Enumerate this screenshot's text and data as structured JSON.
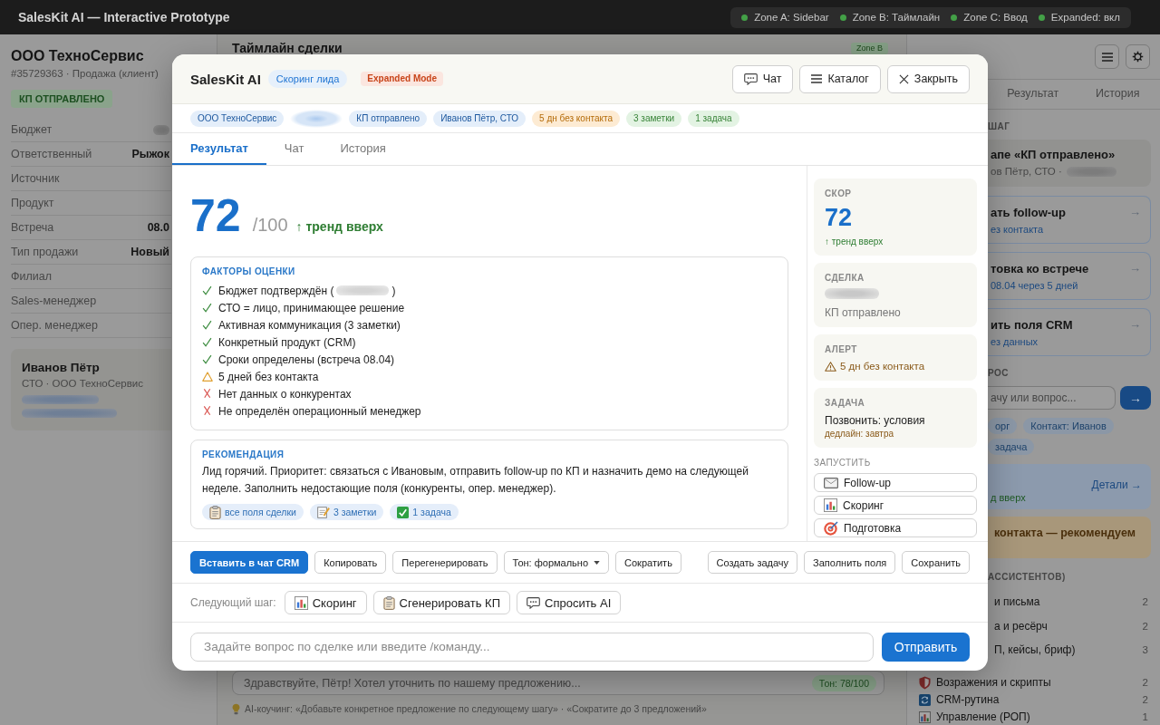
{
  "top_bar": {
    "title": "SalesKit AI — Interactive Prototype",
    "zones": [
      {
        "label": "Zone A: Sidebar",
        "active": true
      },
      {
        "label": "Zone B: Таймлайн",
        "active": true
      },
      {
        "label": "Zone C: Ввод",
        "active": true
      },
      {
        "label": "Expanded: вкл",
        "active": true
      }
    ]
  },
  "deal_sidebar": {
    "company": "ООО ТехноСервис",
    "subtitle": "#35729363 · Продажа (клиент)",
    "stage": "КП ОТПРАВЛЕНО",
    "fields": [
      {
        "label": "Бюджет",
        "value_blurred": true
      },
      {
        "label": "Ответственный",
        "value": "Рыжок"
      },
      {
        "label": "Источник"
      },
      {
        "label": "Продукт"
      },
      {
        "label": "Встреча",
        "value": "08.0"
      },
      {
        "label": "Тип продажи",
        "value": "Новый"
      },
      {
        "label": "Филиал"
      },
      {
        "label": "Sales-менеджер"
      },
      {
        "label": "Опер. менеджер"
      }
    ],
    "contact": {
      "name": "Иванов Пётр",
      "role": "СТО · ООО ТехноСервис",
      "blurred_lines": [
        {
          "kind": "link"
        },
        {
          "kind": "link"
        }
      ]
    }
  },
  "timeline": {
    "title": "Таймлайн сделки",
    "zone_badge": "Zone B",
    "draft": "Здравствуйте, Пётр! Хотел уточнить по нашему предложению...",
    "tone": "Тон: 78/100",
    "coaching": "AI-коучинг: «Добавьте конкретное предложение по следующему шагу» · «Сократите до 3 предложений»"
  },
  "assistant_panel": {
    "tabs": [
      {
        "label": "Результат",
        "selected": false
      },
      {
        "label": "История",
        "selected": false
      }
    ],
    "step_heading": "ШАГ",
    "step_card": {
      "title": "апе «КП отправлено»",
      "detail": "ов Пётр, СТО ·",
      "detail_blurred": true
    },
    "suggestions": [
      {
        "title": "ать follow-up",
        "note": "ез контакта",
        "arrow": "→"
      },
      {
        "title": "товка ко встрече",
        "note": "08.04 через 5 дней",
        "arrow": "→"
      },
      {
        "title": "ить поля CRM",
        "note": "ез данных",
        "arrow": "→"
      }
    ],
    "ask_heading": "РОС",
    "ask_placeholder": "ачу или вопрос...",
    "ask_send": "→",
    "chips": [
      "орг",
      "Контакт: Иванов",
      "задача"
    ],
    "score_card": {
      "trend": "д вверх",
      "link": "Детали →"
    },
    "alert_card": "контакта — рекомендуем",
    "catalog_heading": "АССИСТЕНТОВ)",
    "catalog_cut": [
      {
        "label": "и письма",
        "count": "2"
      },
      {
        "label": "а и ресёрч",
        "count": "2"
      },
      {
        "label": "П, кейсы, бриф)",
        "count": "3"
      }
    ],
    "catalog": [
      {
        "label": "Возражения и скрипты",
        "count": "2",
        "kind": "objections"
      },
      {
        "label": "CRM-рутина",
        "count": "2",
        "kind": "crm"
      },
      {
        "label": "Управление (РОП)",
        "count": "1",
        "kind": "management"
      }
    ]
  },
  "dialog": {
    "title": "SalesKit AI",
    "badges": [
      {
        "text": "Скоринг лида",
        "kind": "assistant",
        "color": "#e6f0fb"
      },
      {
        "text": "Expanded Mode",
        "kind": "mode",
        "color": "#fbe6df"
      }
    ],
    "header_buttons": [
      {
        "label": "Чат",
        "kind": "chat"
      },
      {
        "label": "Каталог",
        "kind": "catalog"
      },
      {
        "label": "Закрыть",
        "kind": "close"
      }
    ],
    "context_chips": [
      {
        "text": "ООО ТехноСервис",
        "color": "#e4eefa"
      },
      {
        "value_blurred": true,
        "color": "#d6e5f7"
      },
      {
        "text": "КП отправлено",
        "color": "#e4eefa"
      },
      {
        "text": "Иванов Пётр, СТО",
        "color": "#e4eefa"
      },
      {
        "text": "5 дн без контакта",
        "color": "#fdebd3"
      },
      {
        "text": "3 заметки",
        "color": "#e3f3e3"
      },
      {
        "text": "1 задача",
        "color": "#e3f3e3"
      }
    ],
    "tabs": [
      {
        "label": "Результат",
        "selected": true
      },
      {
        "label": "Чат",
        "selected": false
      },
      {
        "label": "История",
        "selected": false
      }
    ],
    "score": {
      "value": "72",
      "max": "/100",
      "trend": "↑ тренд вверх"
    },
    "factors": {
      "heading": "ФАКТОРЫ ОЦЕНКИ",
      "items": [
        {
          "kind": "ok",
          "text": "Бюджет подтверждён (",
          "value_blurred": true,
          "text_after": ")"
        },
        {
          "kind": "ok",
          "text": "СТО = лицо, принимающее решение"
        },
        {
          "kind": "ok",
          "text": "Активная коммуникация (3 заметки)"
        },
        {
          "kind": "ok",
          "text": "Конкретный продукт (CRM)"
        },
        {
          "kind": "ok",
          "text": "Сроки определены (встреча 08.04)"
        },
        {
          "kind": "warning",
          "text": "5 дней без контакта"
        },
        {
          "kind": "missing",
          "text": "Нет данных о конкурентах"
        },
        {
          "kind": "missing",
          "text": "Не определён операционный менеджер"
        }
      ]
    },
    "recommendation": {
      "heading": "РЕКОМЕНДАЦИЯ",
      "text": "Лид горячий. Приоритет: связаться с Ивановым, отправить follow-up по КП и назначить демо на следующей неделе. Заполнить недостающие поля (конкуренты, опер. менеджер).",
      "sources": [
        {
          "label": "все поля сделки",
          "kind": "fields"
        },
        {
          "label": "3 заметки",
          "kind": "notes"
        },
        {
          "label": "1 задача",
          "kind": "task"
        }
      ]
    },
    "side_cards": [
      {
        "kind": "score",
        "label": "СКОР",
        "value": "72",
        "note": "↑ тренд вверх"
      },
      {
        "kind": "deal",
        "label": "СДЕЛКА",
        "value_blurred": true,
        "note": "КП отправлено"
      },
      {
        "kind": "alert",
        "label": "АЛЕРТ",
        "note": "5 дн без контакта"
      },
      {
        "kind": "task",
        "label": "ЗАДАЧА",
        "value": "Позвонить: условия",
        "note": "дедлайн: завтра"
      }
    ],
    "launch_heading": "ЗАПУСТИТЬ",
    "launch": [
      {
        "label": "Follow-up",
        "kind": "follow_up"
      },
      {
        "label": "Скоринг",
        "kind": "scoring"
      },
      {
        "label": "Подготовка",
        "kind": "prep"
      }
    ],
    "actions": [
      {
        "label": "Вставить в чат CRM",
        "kind": "primary"
      },
      {
        "label": "Копировать",
        "kind": "plain"
      },
      {
        "label": "Перегенерировать",
        "kind": "plain"
      },
      {
        "label": "Тон: формально",
        "kind": "dropdown"
      },
      {
        "label": "Сократить",
        "kind": "plain"
      }
    ],
    "actions_right": [
      "Создать задачу",
      "Заполнить поля",
      "Сохранить"
    ],
    "next_step": {
      "label": "Следующий шаг:",
      "buttons": [
        {
          "label": "Скоринг",
          "kind": "scoring"
        },
        {
          "label": "Сгенерировать КП",
          "kind": "proposal"
        },
        {
          "label": "Спросить AI",
          "kind": "ask"
        }
      ]
    },
    "composer": {
      "placeholder": "Задайте вопрос по сделке или введите /команду...",
      "send": "Отправить"
    }
  }
}
